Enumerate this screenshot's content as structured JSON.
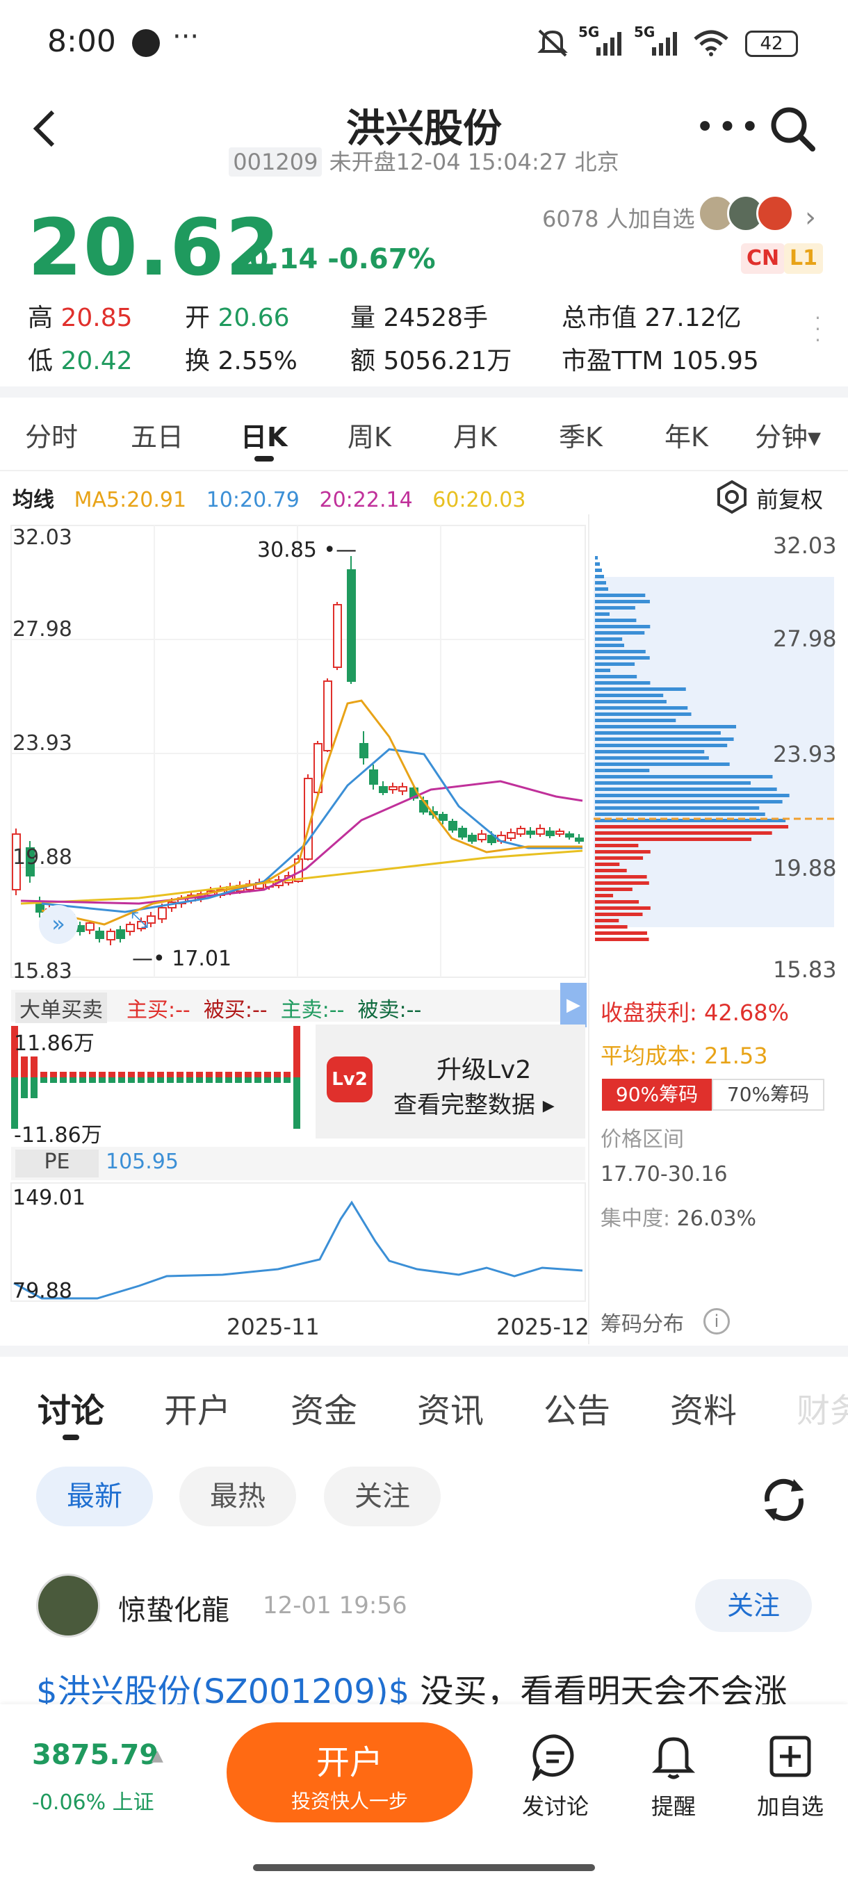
{
  "status": {
    "time": "8:00",
    "dots": "···",
    "net1": "5G",
    "net2": "5G",
    "battery": "42"
  },
  "header": {
    "title": "洪兴股份",
    "code": "001209",
    "market_status": "未开盘12-04 15:04:27 北京"
  },
  "quote": {
    "price": "20.62",
    "change": "-0.14",
    "change_pct": "-0.67%",
    "watch_count": "6078 人加自选",
    "tag_cn": "CN",
    "tag_l1": "L1",
    "stats": {
      "high_label": "高",
      "high": "20.85",
      "open_label": "开",
      "open": "20.66",
      "volume_label": "量",
      "volume": "24528手",
      "mcap_label": "总市值",
      "mcap": "27.12亿",
      "low_label": "低",
      "low": "20.42",
      "turnover_label": "换",
      "turnover": "2.55%",
      "amount_label": "额",
      "amount": "5056.21万",
      "pe_label": "市盈TTM",
      "pe": "105.95"
    }
  },
  "period_tabs": [
    "分时",
    "五日",
    "日K",
    "周K",
    "月K",
    "季K",
    "年K",
    "分钟▾"
  ],
  "ma": {
    "label": "均线",
    "ma5": "MA5:20.91",
    "ma10": "10:20.79",
    "ma20": "20:22.14",
    "ma60": "60:20.03",
    "adjust": "前复权"
  },
  "kline": {
    "y_labels": [
      "32.03",
      "27.98",
      "23.93",
      "19.88",
      "15.83"
    ],
    "high_mark": "30.85",
    "low_mark": "17.01",
    "x_labels": [
      "2025-11",
      "2025-12"
    ]
  },
  "chip_panel": {
    "y_labels": [
      "32.03",
      "27.98",
      "23.93",
      "19.88",
      "15.83"
    ],
    "profit_label": "收盘获利:",
    "profit": "42.68%",
    "avg_cost_label": "平均成本:",
    "avg_cost": "21.53",
    "tab_90": "90%筹码",
    "tab_70": "70%筹码",
    "range_label": "价格区间",
    "range": "17.70-30.16",
    "concentration_label": "集中度:",
    "concentration": "26.03%",
    "footer": "筹码分布"
  },
  "big_order": {
    "label": "大单买卖",
    "main_buy": "主买:--",
    "passive_buy": "被买:--",
    "main_sell": "主卖:--",
    "passive_sell": "被卖:--",
    "top": "11.86万",
    "bottom": "-11.86万",
    "upgrade_title": "升级Lv2",
    "upgrade_sub": "查看完整数据 ▸",
    "badge": "Lv2"
  },
  "pe_chart": {
    "label": "PE",
    "value": "105.95",
    "top": "149.01",
    "bottom": "79.88"
  },
  "content_tabs": [
    "讨论",
    "开户",
    "资金",
    "资讯",
    "公告",
    "资料",
    "财务"
  ],
  "filters": [
    "最新",
    "最热",
    "关注"
  ],
  "post": {
    "user": "惊蛰化龍",
    "time": "12-01 19:56",
    "follow": "关注",
    "link": "$洪兴股份(SZ001209)$",
    "text": " 没买，看看明天会不会涨"
  },
  "bottom": {
    "index_value": "3875.79",
    "index_change": "-0.06% 上证",
    "cta_main": "开户",
    "cta_sub": "投资快人一步",
    "discuss": "发讨论",
    "remind": "提醒",
    "add_watch": "加自选"
  },
  "colors": {
    "up": "#e0302c",
    "down": "#1f9a5e",
    "accent": "#ff6a13",
    "ma5": "#e8a317",
    "ma10": "#3b8fd6",
    "ma20": "#c0309a",
    "ma60": "#e8c020"
  }
}
